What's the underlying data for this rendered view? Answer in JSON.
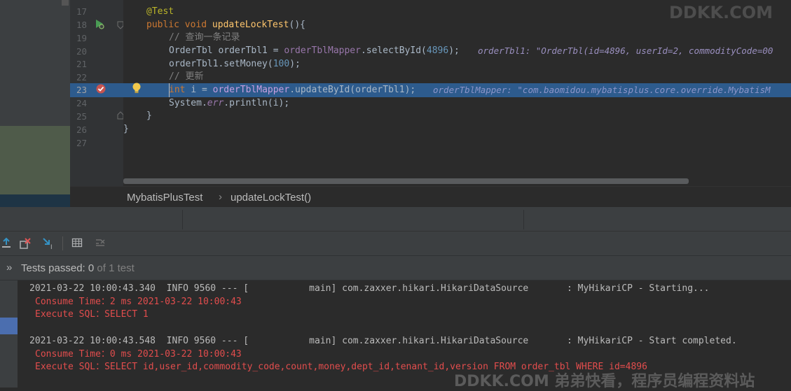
{
  "editor": {
    "line_numbers": [
      "17",
      "18",
      "19",
      "20",
      "21",
      "22",
      "23",
      "24",
      "25",
      "26",
      "27"
    ],
    "lines": {
      "l17": "@Test",
      "l18_kw": "public void ",
      "l18_fn": "updateLockTest",
      "l18_rest": "(){",
      "l19": "// 查询一条记录",
      "l20_a": "OrderTbl orderTbl1 = ",
      "l20_mapper": "orderTblMapper",
      "l20_b": ".selectById(",
      "l20_num": "4896",
      "l20_c": ");",
      "l20_hint": "orderTbl1: \"OrderTbl(id=4896, userId=2, commodityCode=00",
      "l21_a": "orderTbl1.setMoney(",
      "l21_num": "100",
      "l21_b": ");",
      "l22": "// 更新",
      "l23_kw": "int ",
      "l23_a": "i = ",
      "l23_mapper": "orderTblMapper",
      "l23_b": ".updateById(orderTbl1);",
      "l23_hint": "orderTblMapper: \"com.baomidou.mybatisplus.core.override.MybatisM",
      "l24_a": "System.",
      "l24_fld": "err",
      "l24_b": ".println(i);",
      "l25": "}",
      "l26": "}"
    }
  },
  "breadcrumb": {
    "class_name": "MybatisPlusTest",
    "separator": "›",
    "method_name": "updateLockTest()"
  },
  "test_status": {
    "chevron": "»",
    "label": "Tests passed: ",
    "passed": "0",
    "of_text": " of 1 test"
  },
  "console": {
    "line1": "2021-03-22 10:00:43.340  INFO 9560 --- [           main] com.zaxxer.hikari.HikariDataSource       : MyHikariCP - Starting...",
    "line2": "Consume Time：2 ms 2021-03-22 10:00:43",
    "line3": "Execute SQL：SELECT 1",
    "line4": "2021-03-22 10:00:43.548  INFO 9560 --- [           main] com.zaxxer.hikari.HikariDataSource       : MyHikariCP - Start completed.",
    "line5": "Consume Time：0 ms 2021-03-22 10:00:43",
    "line6": "Execute SQL：SELECT id,user_id,commodity_code,count,money,dept_id,tenant_id,version FROM order_tbl WHERE id=4896"
  },
  "watermarks": {
    "top": "DDKK.COM",
    "bottom": "DDKK.COM 弟弟快看，程序员编程资料站"
  },
  "icons": {
    "toolbar": [
      "export-up-icon",
      "stop-rerun-icon",
      "import-down-icon",
      "table-icon",
      "merge-icon"
    ],
    "gutter": [
      "run-test-icon",
      "breakpoint-icon",
      "lightbulb-icon"
    ]
  },
  "colors": {
    "editor_bg": "#2b2b2b",
    "highlight_line": "#2d5b8d",
    "keyword": "#cc7832",
    "console_error": "#e24d4d"
  }
}
